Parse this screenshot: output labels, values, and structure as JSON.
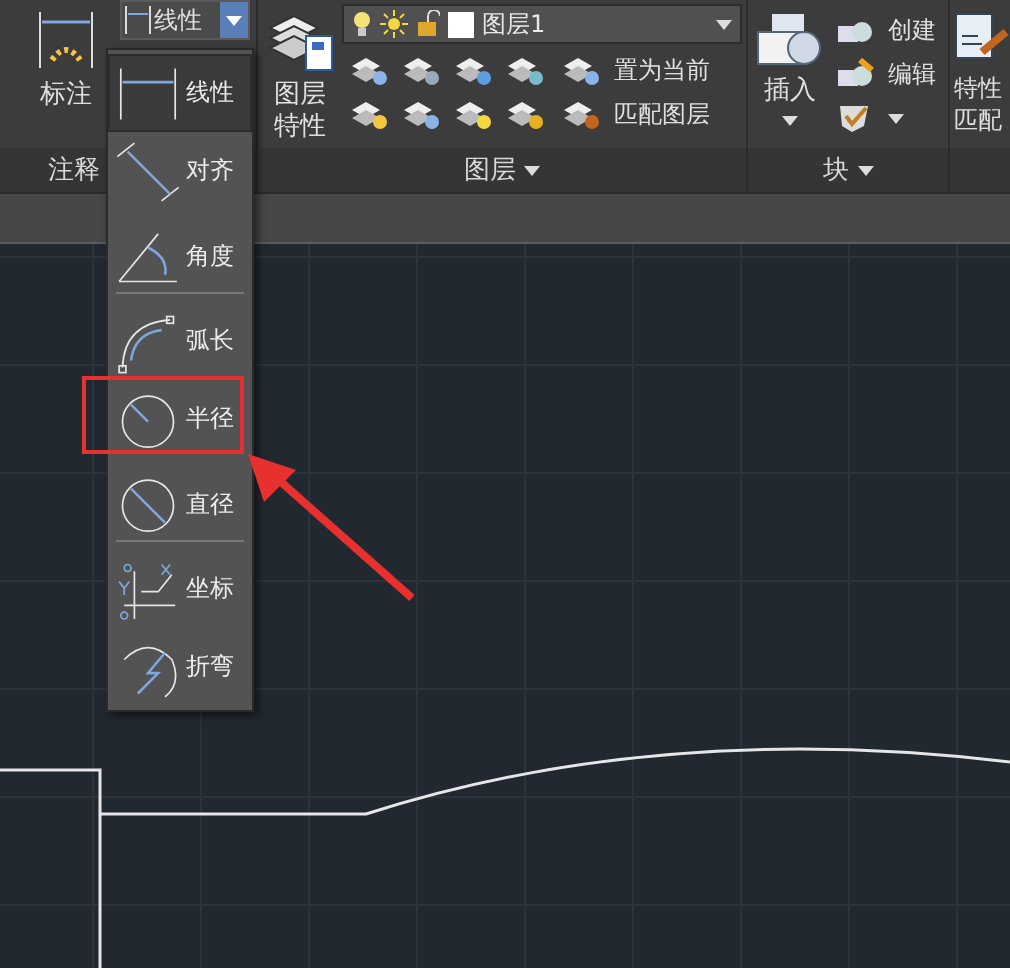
{
  "ribbon": {
    "annotate": {
      "title": "注释",
      "dimension_label": "标注",
      "dimension_dropdown": "线性"
    },
    "layers": {
      "title": "图层",
      "properties_label": [
        "图层",
        "特性"
      ],
      "layer_combo": "图层1",
      "actions": [
        "置为当前",
        "匹配图层"
      ]
    },
    "block": {
      "title": "块",
      "insert_label": "插入",
      "actions": [
        "创建",
        "编辑"
      ]
    },
    "properties": {
      "label": [
        "特性",
        "匹配"
      ]
    }
  },
  "dimension_menu": [
    {
      "label": "线性",
      "kind": "linear",
      "selected": true,
      "separator_after": false,
      "callout": false
    },
    {
      "label": "对齐",
      "kind": "aligned",
      "selected": false,
      "separator_after": false,
      "callout": false
    },
    {
      "label": "角度",
      "kind": "angular",
      "selected": false,
      "separator_after": true,
      "callout": false
    },
    {
      "label": "弧长",
      "kind": "arc",
      "selected": false,
      "separator_after": false,
      "callout": false
    },
    {
      "label": "半径",
      "kind": "radius",
      "selected": false,
      "separator_after": false,
      "callout": true
    },
    {
      "label": "直径",
      "kind": "diameter",
      "selected": false,
      "separator_after": true,
      "callout": false
    },
    {
      "label": "坐标",
      "kind": "ordinate",
      "selected": false,
      "separator_after": false,
      "callout": false
    },
    {
      "label": "折弯",
      "kind": "jogged",
      "selected": false,
      "separator_after": false,
      "callout": false
    }
  ]
}
